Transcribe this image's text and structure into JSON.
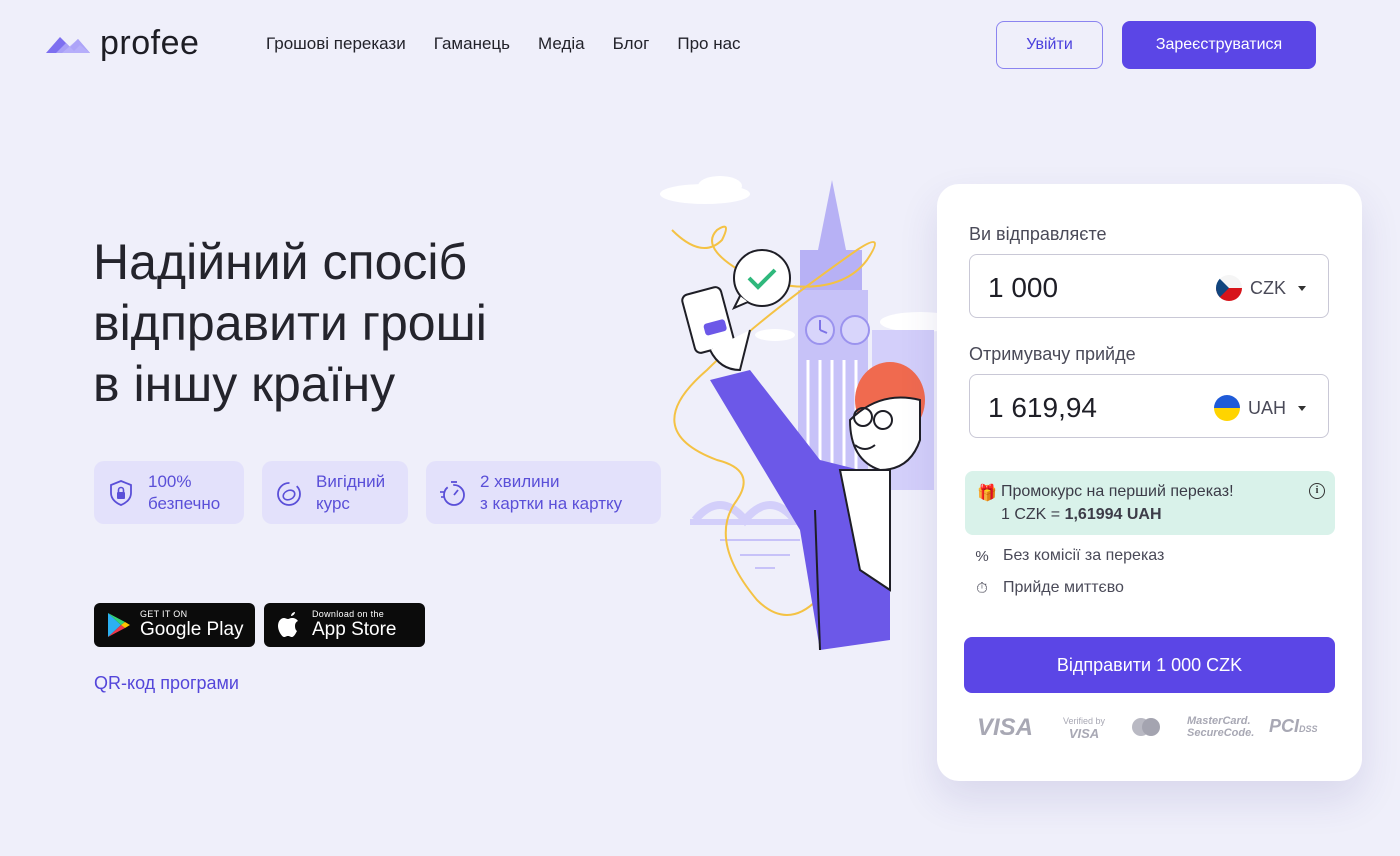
{
  "header": {
    "logo_text": "profee",
    "nav": [
      "Грошові перекази",
      "Гаманець",
      "Медіа",
      "Блог",
      "Про нас"
    ],
    "login_label": "Увійти",
    "register_label": "Зареєструватися"
  },
  "hero": {
    "title_lines": [
      "Надійний спосіб",
      "відправити гроші",
      "в іншу країну"
    ],
    "features": [
      {
        "icon": "shield-lock-icon",
        "lines": [
          "100%",
          "безпечно"
        ]
      },
      {
        "icon": "exchange-rate-icon",
        "lines": [
          "Вигідний",
          "курс"
        ]
      },
      {
        "icon": "stopwatch-icon",
        "lines": [
          "2 хвилини",
          "з картки на картку"
        ]
      }
    ],
    "google_play": {
      "small": "GET IT ON",
      "big": "Google Play"
    },
    "app_store": {
      "small": "Download on the",
      "big": "App Store"
    },
    "qr_link": "QR-код програми"
  },
  "calculator": {
    "send_label": "Ви відправляєте",
    "send_amount": "1 000",
    "send_currency": "CZK",
    "receive_label": "Отримувачу прийде",
    "receive_amount": "1 619,94",
    "receive_currency": "UAH",
    "promo_title": "Промокурс на перший переказ!",
    "promo_rate_prefix": "1 CZK = ",
    "promo_rate_value": "1,61994 UAH",
    "perks": [
      {
        "icon": "percent-icon",
        "text": "Без комісії за переказ"
      },
      {
        "icon": "timer-icon",
        "text": "Прийде миттєво"
      }
    ],
    "send_button": "Відправити 1 000 CZK",
    "payment_logos": {
      "visa": "VISA",
      "verified_by": "Verified by",
      "verified_visa": "VISA",
      "mc_line1": "MasterCard.",
      "mc_line2": "SecureCode.",
      "pci": "PCI",
      "dss": "DSS"
    }
  },
  "colors": {
    "background": "#efeffa",
    "accent": "#5b46e6",
    "feature_bg": "#e3e1fb",
    "promo_bg": "#d9f2ea"
  }
}
